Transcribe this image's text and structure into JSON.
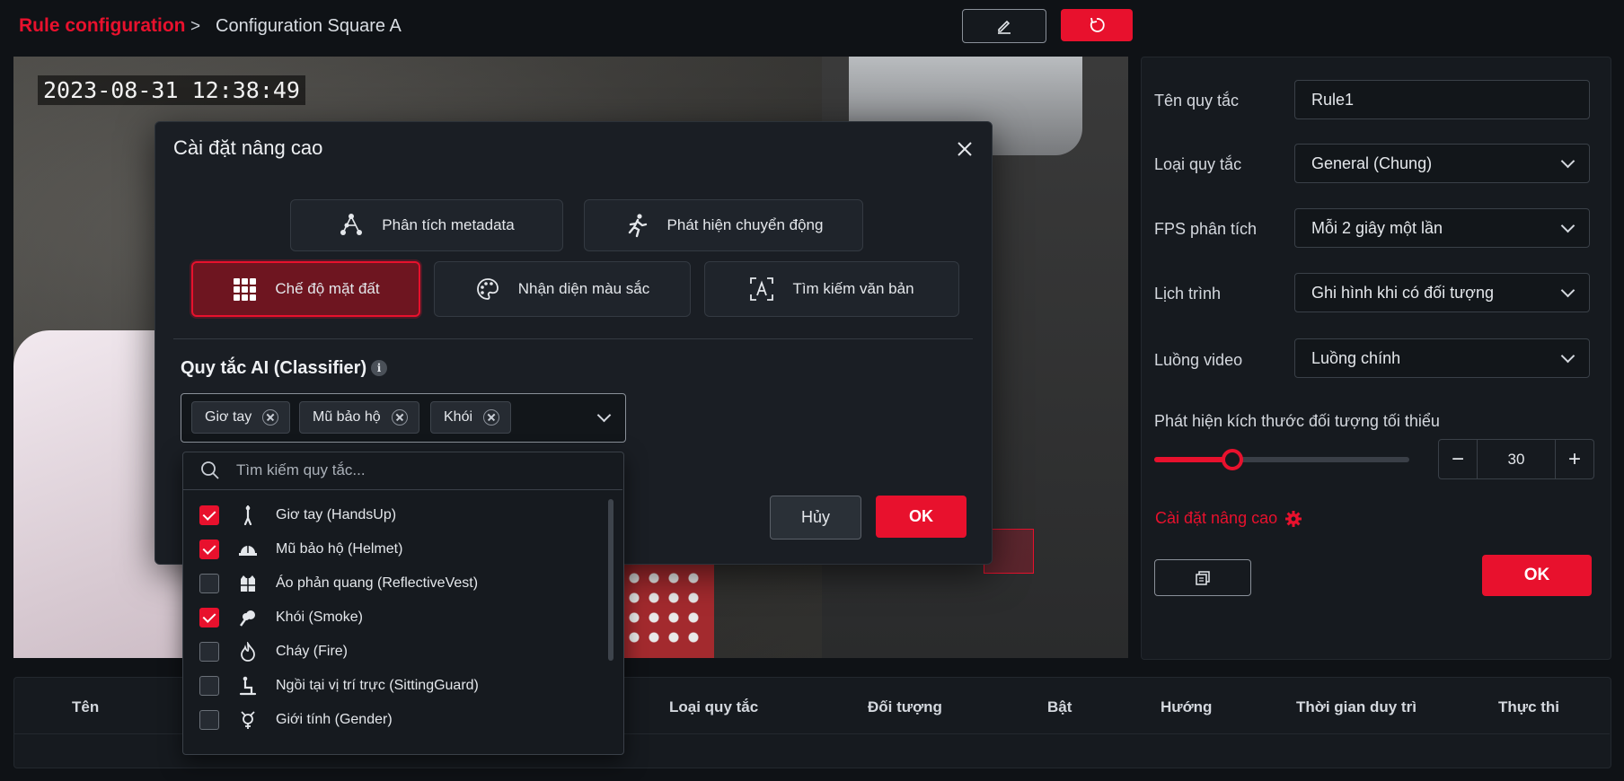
{
  "breadcrumb": {
    "root": "Rule configuration",
    "separator": ">",
    "current": "Configuration Square A"
  },
  "video": {
    "timestamp": "2023-08-31 12:38:49"
  },
  "right_panel": {
    "rule_name_label": "Tên quy tắc",
    "rule_name_value": "Rule1",
    "rule_type_label": "Loại quy tắc",
    "rule_type_value": "General (Chung)",
    "fps_label": "FPS phân tích",
    "fps_value": "Mỗi 2 giây một lần",
    "schedule_label": "Lịch trình",
    "schedule_value": "Ghi hình khi có đối tượng",
    "stream_label": "Luồng video",
    "stream_value": "Luồng chính",
    "min_size_label": "Phát hiện kích thước đối tượng tối thiểu",
    "min_size_value": "30",
    "min_size_slider_fraction": 0.3,
    "advanced_link": "Cài đặt nâng cao",
    "ok_label": "OK"
  },
  "table": {
    "headers": [
      "Tên",
      "Loại quy tắc",
      "Đối tượng",
      "Bật",
      "Hướng",
      "Thời gian duy trì",
      "Thực thi"
    ]
  },
  "modal": {
    "title": "Cài đặt nâng cao",
    "tiles": [
      {
        "label": "Phân tích metadata",
        "icon": "metadata-graph-icon"
      },
      {
        "label": "Phát hiện chuyển động",
        "icon": "running-person-icon"
      },
      {
        "label": "Chế độ mặt đất",
        "icon": "grid-icon",
        "active": true
      },
      {
        "label": "Nhận diện màu sắc",
        "icon": "palette-icon"
      },
      {
        "label": "Tìm kiếm văn bản",
        "icon": "text-scan-icon"
      }
    ],
    "ai_title": "Quy tắc AI (Classifier)",
    "selected_chips": [
      "Giơ tay",
      "Mũ bảo hộ",
      "Khói"
    ],
    "cancel_label": "Hủy",
    "ok_label": "OK"
  },
  "dropdown": {
    "search_placeholder": "Tìm kiếm quy tắc...",
    "items": [
      {
        "label": "Giơ tay (HandsUp)",
        "checked": true,
        "icon": "hands-up-person-icon"
      },
      {
        "label": "Mũ bảo hộ (Helmet)",
        "checked": true,
        "icon": "helmet-icon"
      },
      {
        "label": "Áo phản quang (ReflectiveVest)",
        "checked": false,
        "icon": "vest-icon"
      },
      {
        "label": "Khói (Smoke)",
        "checked": true,
        "icon": "smoke-icon"
      },
      {
        "label": "Cháy (Fire)",
        "checked": false,
        "icon": "fire-icon"
      },
      {
        "label": "Ngồi tại vị trí trực (SittingGuard)",
        "checked": false,
        "icon": "sitting-person-icon"
      },
      {
        "label": "Giới tính (Gender)",
        "checked": false,
        "icon": "gender-icon"
      }
    ]
  },
  "colors": {
    "accent": "#e8112d",
    "background": "#0f1216",
    "panel": "#161a1f"
  }
}
